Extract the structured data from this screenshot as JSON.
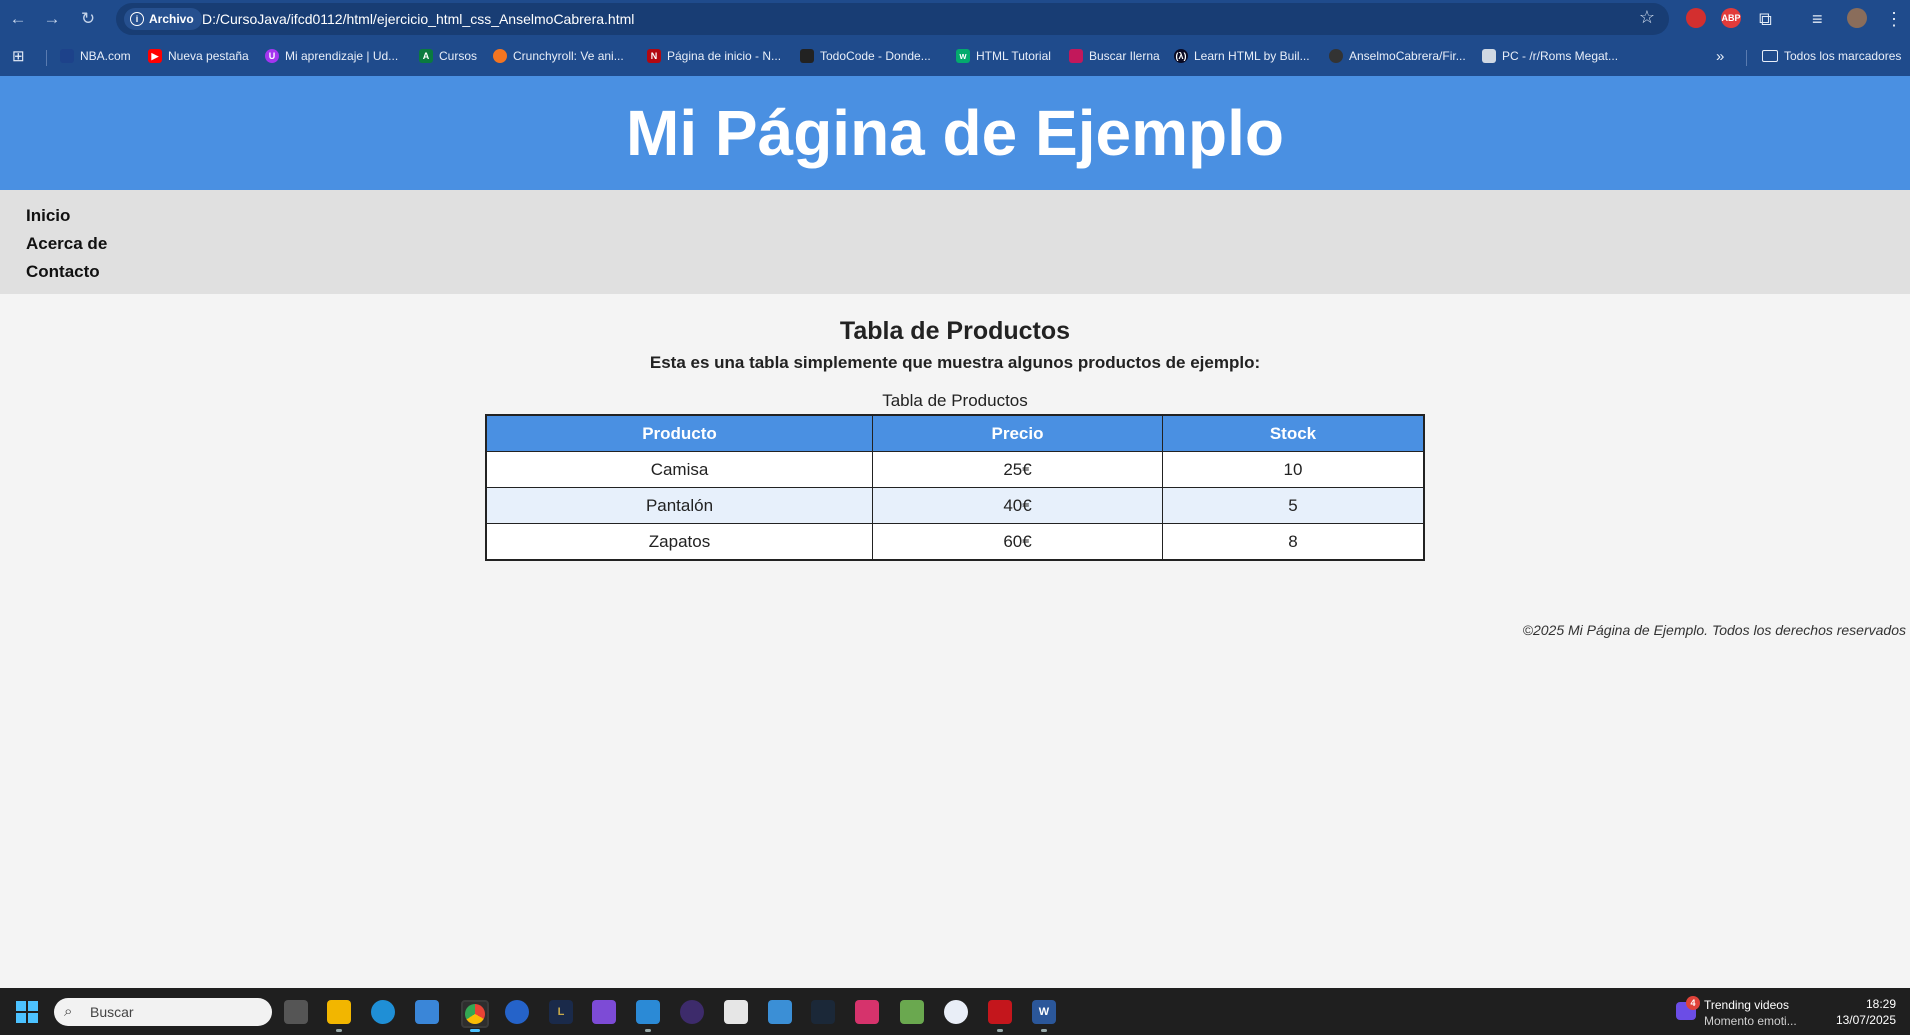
{
  "browser": {
    "site_chip": "Archivo",
    "url": "D:/CursoJava/ifcd0112/html/ejercicio_html_css_AnselmoCabrera.html",
    "bookmarks": [
      "NBA.com",
      "Nueva pestaña",
      "Mi aprendizaje | Ud...",
      "Cursos",
      "Crunchyroll: Ve ani...",
      "Página de inicio - N...",
      "TodoCode - Donde...",
      "HTML Tutorial",
      "Buscar Ilerna",
      "Learn HTML by Buil...",
      "AnselmoCabrera/Fir...",
      "PC - /r/Roms Megat..."
    ],
    "all_bookmarks": "Todos los marcadores",
    "extensions": {
      "abp": "ABP"
    }
  },
  "page": {
    "header_title": "Mi Página de Ejemplo",
    "nav": [
      "Inicio",
      "Acerca de",
      "Contacto"
    ],
    "section_title": "Tabla de Productos",
    "section_desc": "Esta es una tabla simplemente que muestra algunos productos de ejemplo:",
    "table": {
      "caption": "Tabla de Productos",
      "headers": [
        "Producto",
        "Precio",
        "Stock"
      ],
      "rows": [
        [
          "Camisa",
          "25€",
          "10"
        ],
        [
          "Pantalón",
          "40€",
          "5"
        ],
        [
          "Zapatos",
          "60€",
          "8"
        ]
      ]
    },
    "footer": "©2025 Mi Página de Ejemplo. Todos los derechos reservados",
    "colors": {
      "header_bg": "#4a90e2",
      "nav_bg": "#e0e0e0",
      "page_bg": "#f4f4f4",
      "row_alt_bg": "#e7f0fb"
    }
  },
  "taskbar": {
    "search_placeholder": "Buscar",
    "notification": {
      "badge": "4",
      "title": "Trending videos",
      "subtitle": "Momento emoti..."
    },
    "time": "18:29",
    "date": "13/07/2025"
  }
}
